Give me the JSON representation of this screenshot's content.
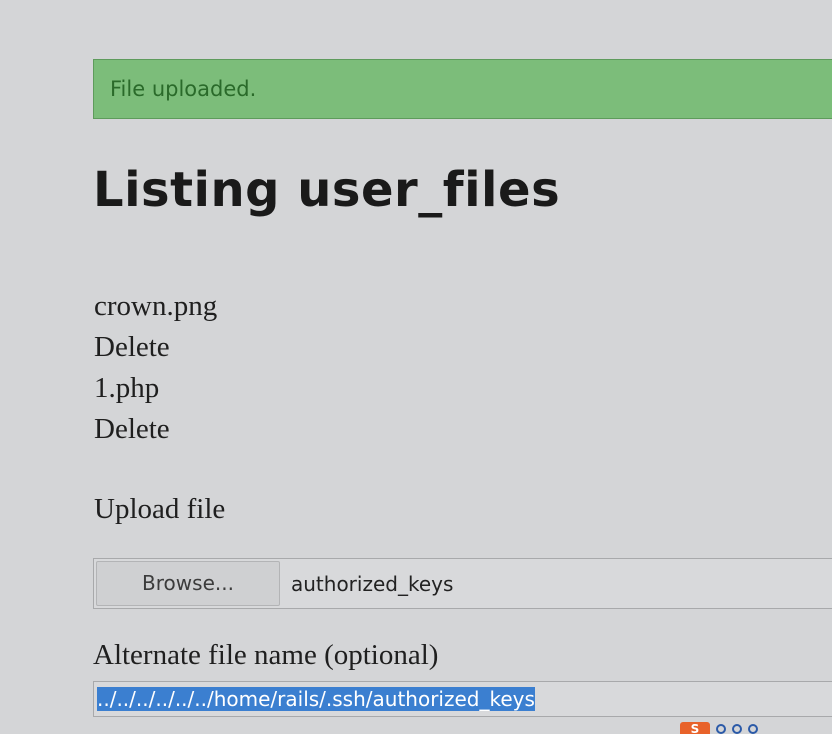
{
  "flash": {
    "message": "File uploaded."
  },
  "page": {
    "title": "Listing user_files"
  },
  "files": [
    {
      "name": "crown.png",
      "delete_label": "Delete"
    },
    {
      "name": "1.php",
      "delete_label": "Delete"
    }
  ],
  "upload": {
    "label": "Upload file",
    "browse_label": "Browse...",
    "selected_file": "authorized_keys"
  },
  "alternate_name": {
    "label": "Alternate file name (optional)",
    "value": "../../../../../../home/rails/.ssh/authorized_keys"
  },
  "colors": {
    "flash_background": "#7cbd7a",
    "flash_text": "#2a6a2a",
    "selection": "#3b7fd0",
    "page_background": "#d4d5d7"
  }
}
